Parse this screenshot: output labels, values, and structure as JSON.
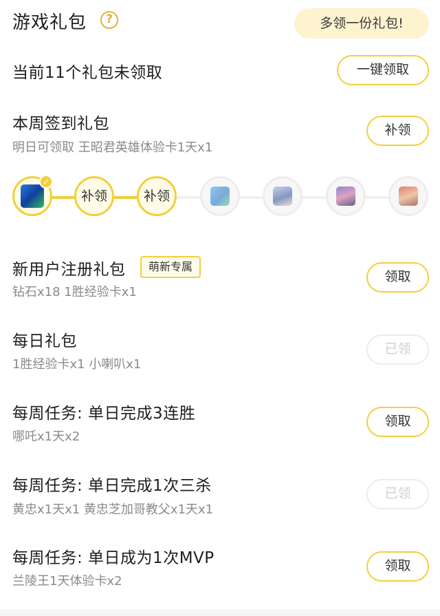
{
  "header": {
    "title": "游戏礼包",
    "help_icon": "?",
    "extra_pill": "多领一份礼包!"
  },
  "summary": {
    "text": "当前11个礼包未领取",
    "claim_all_label": "一键领取"
  },
  "weekly_signin": {
    "title": "本周签到礼包",
    "subtitle": "明日可领取 王昭君英雄体验卡1天x1",
    "button_label": "补领",
    "days": [
      {
        "state": "claimed",
        "icon": "card-icon",
        "label": ""
      },
      {
        "state": "makeup",
        "icon": "",
        "label": "补领"
      },
      {
        "state": "makeup",
        "icon": "",
        "label": "补领"
      },
      {
        "state": "future",
        "icon": "card-icon",
        "label": ""
      },
      {
        "state": "future",
        "icon": "hero-avatar-icon",
        "label": ""
      },
      {
        "state": "future",
        "icon": "hero-avatar-icon",
        "label": ""
      },
      {
        "state": "future",
        "icon": "hero-avatar-icon",
        "label": ""
      }
    ]
  },
  "new_user": {
    "title": "新用户注册礼包",
    "badge": "萌新专属",
    "subtitle": "钻石x18 1胜经验卡x1",
    "button_label": "领取"
  },
  "daily": {
    "title": "每日礼包",
    "subtitle": "1胜经验卡x1 小喇叭x1",
    "button_label": "已领"
  },
  "task1": {
    "title": "每周任务:  单日完成3连胜",
    "subtitle": "哪吒x1天x2",
    "button_label": "领取"
  },
  "task2": {
    "title": "每周任务:  单日完成1次三杀",
    "subtitle": "黄忠x1天x1 黄忠芝加哥教父x1天x1",
    "button_label": "已领"
  },
  "task3": {
    "title": "每周任务:  单日成为1次MVP",
    "subtitle": "兰陵王1天体验卡x2",
    "button_label": "领取"
  },
  "colors": {
    "accent": "#f2cf3a",
    "pill_bg": "#fdf3cf",
    "help": "#e2b33a",
    "muted_text": "#8a8a8a",
    "disabled": "#cfcfcf"
  }
}
